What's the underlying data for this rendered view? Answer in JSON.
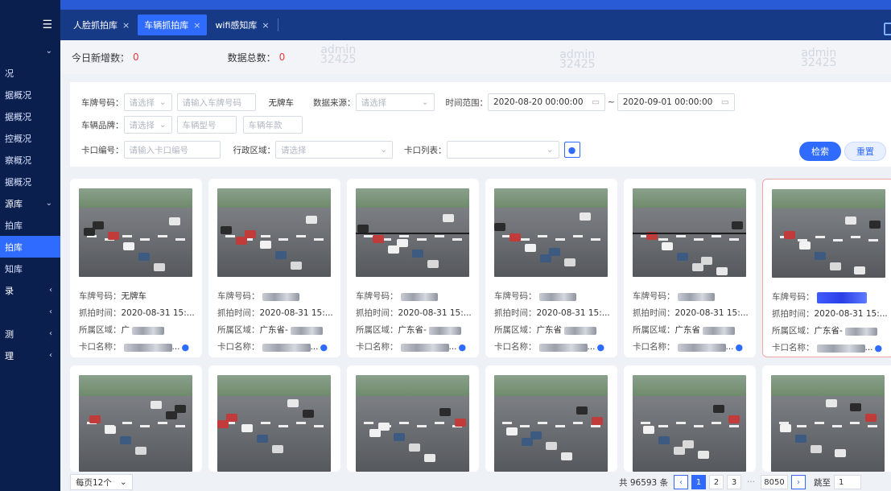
{
  "sidebar": {
    "items": [
      {
        "label": "况",
        "type": "sub"
      },
      {
        "label": "据概况",
        "type": "sub"
      },
      {
        "label": "据概况",
        "type": "sub"
      },
      {
        "label": "控概况",
        "type": "sub"
      },
      {
        "label": "察概况",
        "type": "sub"
      },
      {
        "label": "据概况",
        "type": "sub"
      },
      {
        "label": "源库",
        "type": "group"
      },
      {
        "label": "拍库",
        "type": "sub"
      },
      {
        "label": "拍库",
        "type": "active"
      },
      {
        "label": "知库",
        "type": "sub"
      },
      {
        "label": "录",
        "type": "group"
      },
      {
        "label": "",
        "type": "group"
      },
      {
        "label": "测",
        "type": "group"
      },
      {
        "label": "理",
        "type": "group"
      }
    ]
  },
  "tabs": [
    {
      "label": "人脸抓拍库",
      "close": "×"
    },
    {
      "label": "车辆抓拍库",
      "close": "×"
    },
    {
      "label": "wifi感知库",
      "close": "×"
    }
  ],
  "stats": {
    "new_today_label": "今日新增数：",
    "new_today_value": "0",
    "total_label": "数据总数：",
    "total_value": "0"
  },
  "watermark": {
    "line1": "admin",
    "line2": "32425"
  },
  "filters": {
    "plate_label": "车牌号码：",
    "plate_select": "请选择",
    "plate_input_placeholder": "请输入车牌号码",
    "no_plate": "无牌车",
    "source_label": "数据来源：",
    "source_select": "请选择",
    "time_label": "时间范围：",
    "time_start": "2020-08-20 00:00:00",
    "time_sep": "~",
    "time_end": "2020-09-01 00:00:00",
    "brand_label": "车辆品牌：",
    "brand_select": "请选择",
    "model_placeholder": "车辆型号",
    "style_placeholder": "车辆年款",
    "bayonet_label": "卡口编号：",
    "bayonet_placeholder": "请输入卡口编号",
    "region_label": "行政区域：",
    "region_select": "请选择",
    "bayonet_list_label": "卡口列表：",
    "bayonet_list_select": "",
    "search": "检索",
    "reset": "重置"
  },
  "card_labels": {
    "plate": "车牌号码：",
    "time": "抓拍时间：",
    "area": "所属区域：",
    "bayonet": "卡口名称："
  },
  "cards": [
    {
      "plate": "无牌车",
      "time": "2020-08-31 15:...",
      "area": "广",
      "bayonet": "...",
      "split": false,
      "selected": false
    },
    {
      "plate": "",
      "time": "2020-08-31 15:...",
      "area": "广东省-",
      "bayonet": "...",
      "split": false,
      "selected": false
    },
    {
      "plate": "",
      "time": "2020-08-31 15:...",
      "area": "广东省-",
      "bayonet": "...",
      "split": true,
      "selected": false
    },
    {
      "plate": "",
      "time": "2020-08-31 15:...",
      "area": "广东省",
      "bayonet": "...",
      "split": false,
      "selected": false
    },
    {
      "plate": "",
      "time": "2020-08-31 15:...",
      "area": "广东省",
      "bayonet": "...",
      "split": true,
      "selected": false
    },
    {
      "plate": "",
      "time": "2020-08-31 15:...",
      "area": "广东省-",
      "bayonet": "...",
      "split": false,
      "selected": true
    }
  ],
  "pager": {
    "page_size": "每页12个",
    "total": "共 96593 条",
    "pages": [
      "1",
      "2",
      "3"
    ],
    "ellipsis": "···",
    "last": "8050",
    "jump_label": "跳至",
    "jump_value": "1"
  }
}
